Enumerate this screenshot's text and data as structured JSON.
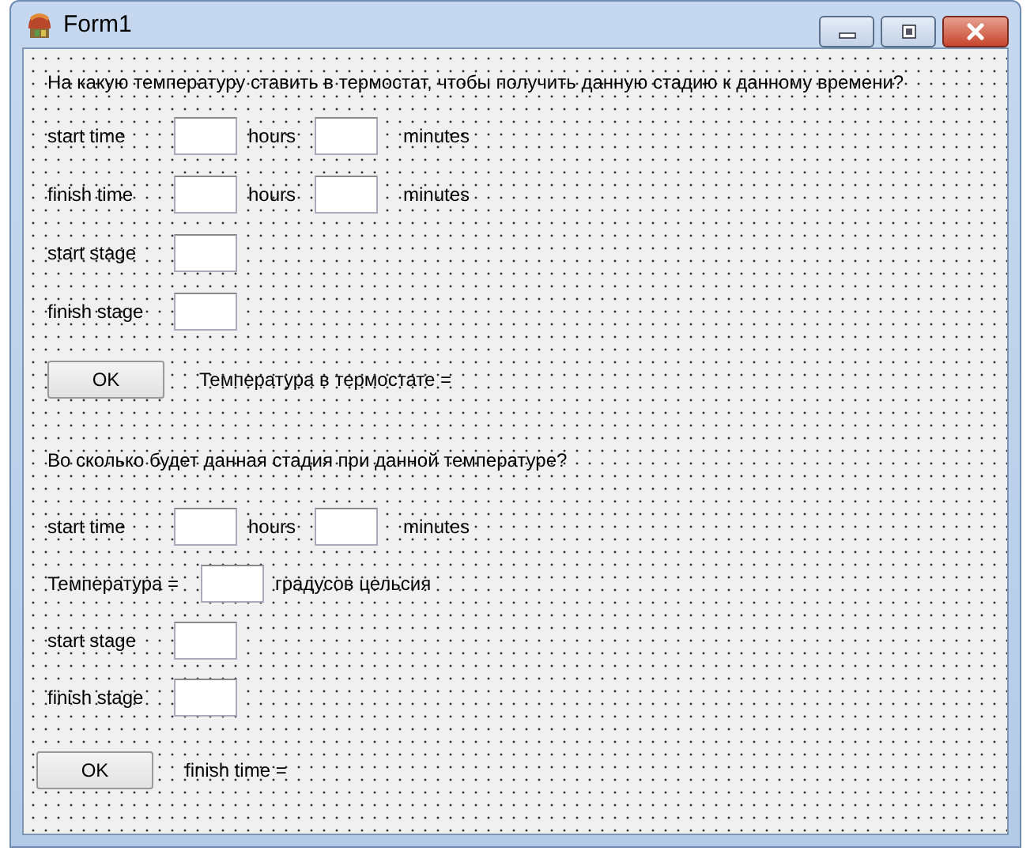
{
  "window": {
    "title": "Form1"
  },
  "sections": [
    {
      "question": "На какую температуру ставить в термостат, чтобы получить данную стадию к данному времени?",
      "rows": [
        {
          "kind": "time",
          "label": "start time",
          "unit_1": "hours",
          "unit_2": "minutes"
        },
        {
          "kind": "time",
          "label": "finish time",
          "unit_1": "hours",
          "unit_2": "minutes"
        },
        {
          "kind": "value",
          "label": "start stage"
        },
        {
          "kind": "value",
          "label": "finish stage"
        }
      ],
      "button": "OK",
      "result": "Температура в термостате ="
    },
    {
      "question": "Во сколько будет данная стадия при данной температуре?",
      "rows": [
        {
          "kind": "time",
          "label": "start time",
          "unit_1": "hours",
          "unit_2": "minutes"
        },
        {
          "kind": "value",
          "label": "Температура =",
          "unit": "градусов цельсия"
        },
        {
          "kind": "value",
          "label": "start stage"
        },
        {
          "kind": "value",
          "label": "finish stage"
        }
      ],
      "button": "OK",
      "result": "finish time ="
    }
  ]
}
